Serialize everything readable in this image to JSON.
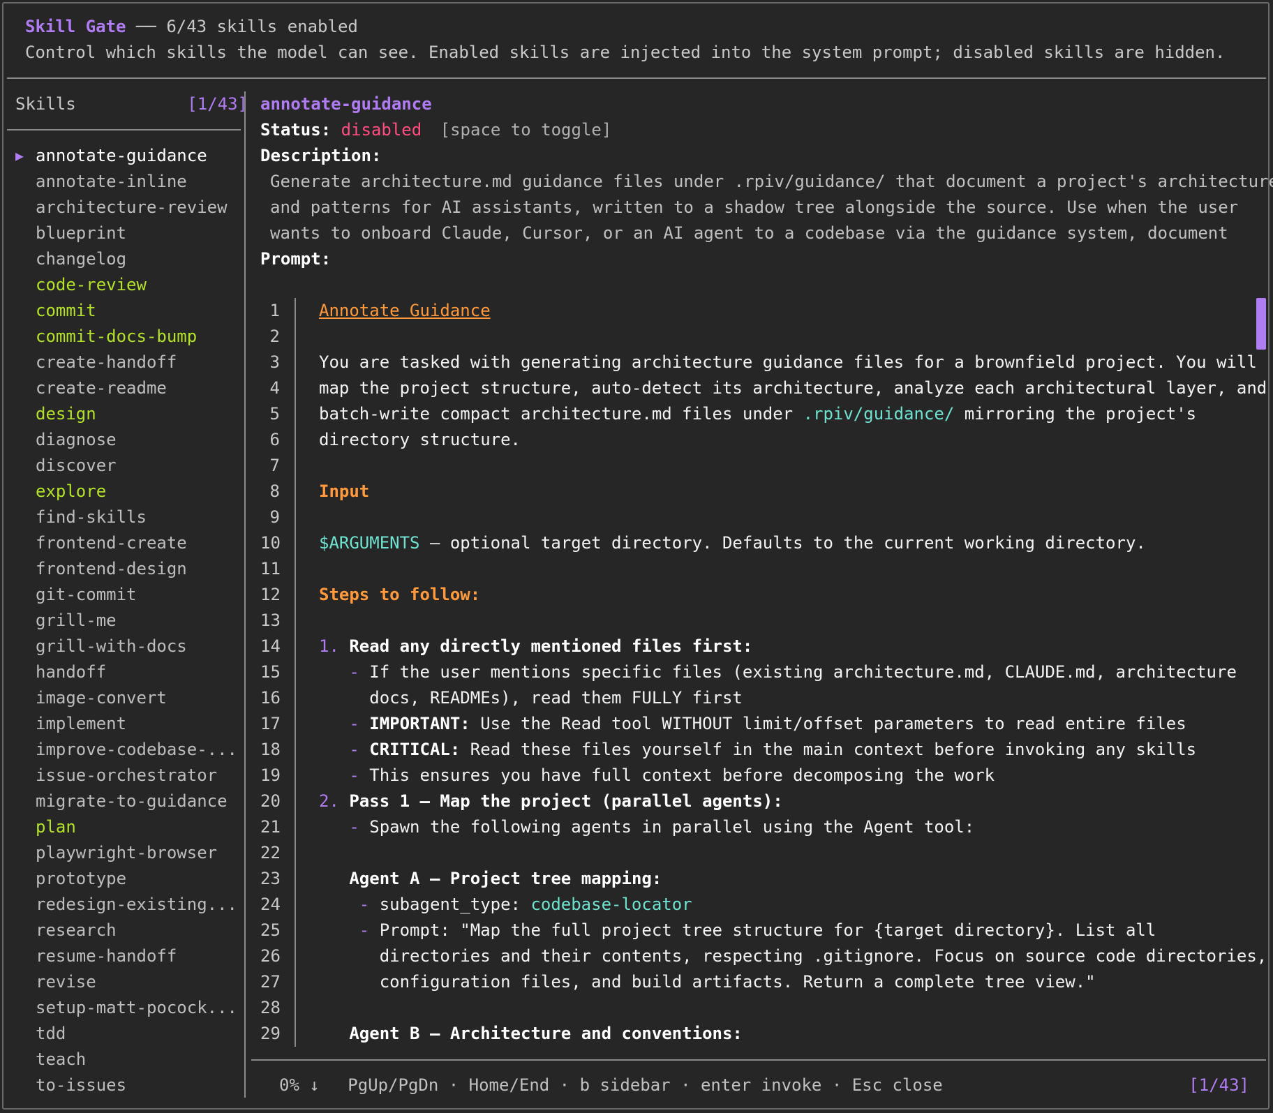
{
  "header": {
    "title": "Skill Gate",
    "separator": "──",
    "enabled_count": "6/43 skills enabled",
    "description": "Control which skills the model can see. Enabled skills are injected into the system prompt; disabled skills are hidden."
  },
  "sidebar": {
    "title": "Skills",
    "position": "[1/43]",
    "selected_marker": "▶",
    "items": [
      {
        "name": "annotate-guidance",
        "enabled": false,
        "selected": true
      },
      {
        "name": "annotate-inline",
        "enabled": false
      },
      {
        "name": "architecture-review",
        "enabled": false
      },
      {
        "name": "blueprint",
        "enabled": false
      },
      {
        "name": "changelog",
        "enabled": false
      },
      {
        "name": "code-review",
        "enabled": true
      },
      {
        "name": "commit",
        "enabled": true
      },
      {
        "name": "commit-docs-bump",
        "enabled": true
      },
      {
        "name": "create-handoff",
        "enabled": false
      },
      {
        "name": "create-readme",
        "enabled": false
      },
      {
        "name": "design",
        "enabled": true
      },
      {
        "name": "diagnose",
        "enabled": false
      },
      {
        "name": "discover",
        "enabled": false
      },
      {
        "name": "explore",
        "enabled": true
      },
      {
        "name": "find-skills",
        "enabled": false
      },
      {
        "name": "frontend-create",
        "enabled": false
      },
      {
        "name": "frontend-design",
        "enabled": false
      },
      {
        "name": "git-commit",
        "enabled": false
      },
      {
        "name": "grill-me",
        "enabled": false
      },
      {
        "name": "grill-with-docs",
        "enabled": false
      },
      {
        "name": "handoff",
        "enabled": false
      },
      {
        "name": "image-convert",
        "enabled": false
      },
      {
        "name": "implement",
        "enabled": false
      },
      {
        "name": "improve-codebase-...",
        "enabled": false
      },
      {
        "name": "issue-orchestrator",
        "enabled": false
      },
      {
        "name": "migrate-to-guidance",
        "enabled": false
      },
      {
        "name": "plan",
        "enabled": true
      },
      {
        "name": "playwright-browser",
        "enabled": false
      },
      {
        "name": "prototype",
        "enabled": false
      },
      {
        "name": "redesign-existing...",
        "enabled": false
      },
      {
        "name": "research",
        "enabled": false
      },
      {
        "name": "resume-handoff",
        "enabled": false
      },
      {
        "name": "revise",
        "enabled": false
      },
      {
        "name": "setup-matt-pocock...",
        "enabled": false
      },
      {
        "name": "tdd",
        "enabled": false
      },
      {
        "name": "teach",
        "enabled": false
      },
      {
        "name": "to-issues",
        "enabled": false
      }
    ]
  },
  "detail": {
    "skill_name": "annotate-guidance",
    "status_label": "Status:",
    "status_value": "disabled",
    "toggle_hint": "[space to toggle]",
    "description_label": "Description:",
    "description_lines": [
      "Generate architecture.md guidance files under .rpiv/guidance/ that document a project's architecture",
      "and patterns for AI assistants, written to a shadow tree alongside the source. Use when the user",
      "wants to onboard Claude, Cursor, or an AI agent to a codebase via the guidance system, document"
    ],
    "prompt_label": "Prompt:"
  },
  "prompt_lines": [
    {
      "n": "1",
      "segs": [
        {
          "t": "Annotate Guidance",
          "c": "h1"
        }
      ]
    },
    {
      "n": "2",
      "segs": []
    },
    {
      "n": "3",
      "segs": [
        {
          "t": "You are tasked with generating architecture guidance files for a brownfield project. You will"
        }
      ]
    },
    {
      "n": "4",
      "segs": [
        {
          "t": "map the project structure, auto-detect its architecture, analyze each architectural layer, and"
        }
      ]
    },
    {
      "n": "5",
      "segs": [
        {
          "t": "batch-write compact architecture.md files under "
        },
        {
          "t": ".rpiv/guidance/",
          "c": "code"
        },
        {
          "t": " mirroring the project's"
        }
      ]
    },
    {
      "n": "6",
      "segs": [
        {
          "t": "directory structure."
        }
      ]
    },
    {
      "n": "7",
      "segs": []
    },
    {
      "n": "8",
      "segs": [
        {
          "t": "Input",
          "c": "h2"
        }
      ]
    },
    {
      "n": "9",
      "segs": []
    },
    {
      "n": "10",
      "segs": [
        {
          "t": "$ARGUMENTS",
          "c": "code"
        },
        {
          "t": " — optional target directory. Defaults to the current working directory."
        }
      ]
    },
    {
      "n": "11",
      "segs": []
    },
    {
      "n": "12",
      "segs": [
        {
          "t": "Steps to follow:",
          "c": "h2"
        }
      ]
    },
    {
      "n": "13",
      "segs": []
    },
    {
      "n": "14",
      "segs": [
        {
          "t": "1. ",
          "c": "num"
        },
        {
          "t": "Read any directly mentioned files first:",
          "c": "b"
        }
      ]
    },
    {
      "n": "15",
      "segs": [
        {
          "t": "   "
        },
        {
          "t": "-",
          "c": "bul"
        },
        {
          "t": " If the user mentions specific files (existing architecture.md, CLAUDE.md, architecture"
        }
      ]
    },
    {
      "n": "16",
      "segs": [
        {
          "t": "     docs, READMEs), read them FULLY first"
        }
      ]
    },
    {
      "n": "17",
      "segs": [
        {
          "t": "   "
        },
        {
          "t": "-",
          "c": "bul"
        },
        {
          "t": " "
        },
        {
          "t": "IMPORTANT:",
          "c": "b"
        },
        {
          "t": " Use the Read tool WITHOUT limit/offset parameters to read entire files"
        }
      ]
    },
    {
      "n": "18",
      "segs": [
        {
          "t": "   "
        },
        {
          "t": "-",
          "c": "bul"
        },
        {
          "t": " "
        },
        {
          "t": "CRITICAL:",
          "c": "b"
        },
        {
          "t": " Read these files yourself in the main context before invoking any skills"
        }
      ]
    },
    {
      "n": "19",
      "segs": [
        {
          "t": "   "
        },
        {
          "t": "-",
          "c": "bul"
        },
        {
          "t": " This ensures you have full context before decomposing the work"
        }
      ]
    },
    {
      "n": "20",
      "segs": [
        {
          "t": "2. ",
          "c": "num"
        },
        {
          "t": "Pass 1 — Map the project (parallel agents):",
          "c": "b"
        }
      ]
    },
    {
      "n": "21",
      "segs": [
        {
          "t": "   "
        },
        {
          "t": "-",
          "c": "bul"
        },
        {
          "t": " Spawn the following agents in parallel using the Agent tool:"
        }
      ]
    },
    {
      "n": "22",
      "segs": []
    },
    {
      "n": "23",
      "segs": [
        {
          "t": "   "
        },
        {
          "t": "Agent A — Project tree mapping:",
          "c": "b"
        }
      ]
    },
    {
      "n": "24",
      "segs": [
        {
          "t": "    "
        },
        {
          "t": "-",
          "c": "bul"
        },
        {
          "t": " subagent_type: "
        },
        {
          "t": "codebase-locator",
          "c": "code"
        }
      ]
    },
    {
      "n": "25",
      "segs": [
        {
          "t": "    "
        },
        {
          "t": "-",
          "c": "bul"
        },
        {
          "t": " Prompt: \"Map the full project tree structure for {target directory}. List all"
        }
      ]
    },
    {
      "n": "26",
      "segs": [
        {
          "t": "      directories and their contents, respecting .gitignore. Focus on source code directories,"
        }
      ]
    },
    {
      "n": "27",
      "segs": [
        {
          "t": "      configuration files, and build artifacts. Return a complete tree view.\""
        }
      ]
    },
    {
      "n": "28",
      "segs": []
    },
    {
      "n": "29",
      "segs": [
        {
          "t": "   "
        },
        {
          "t": "Agent B — Architecture and conventions:",
          "c": "b"
        }
      ]
    }
  ],
  "footer": {
    "scroll": "0% ↓",
    "keys": "PgUp/PgDn · Home/End · b sidebar · enter invoke · Esc close",
    "position": "[1/43]"
  },
  "colors": {
    "background": "#262626",
    "accent": "#b07cf2",
    "enabled": "#b4e22a",
    "disabled": "#ff4d80",
    "heading": "#ff9a3c",
    "code": "#6ee3d0"
  }
}
